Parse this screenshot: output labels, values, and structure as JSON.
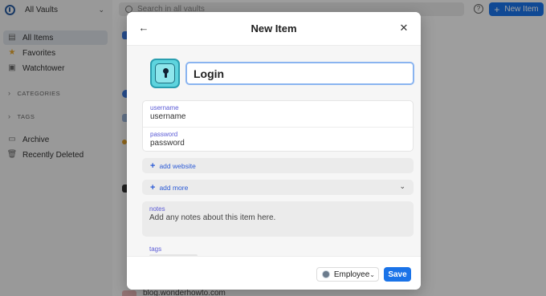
{
  "app": {
    "vault_switcher": {
      "label": "All Vaults",
      "icon": "onepassword-logo-icon"
    },
    "sidebar": {
      "items": [
        {
          "label": "All Items",
          "icon": "all-items-icon",
          "active": true
        },
        {
          "label": "Favorites",
          "icon": "star-icon"
        },
        {
          "label": "Watchtower",
          "icon": "watchtower-icon"
        }
      ],
      "sections": [
        {
          "label": "CATEGORIES"
        },
        {
          "label": "TAGS"
        }
      ],
      "footer_items": [
        {
          "label": "Archive",
          "icon": "archive-icon"
        },
        {
          "label": "Recently Deleted",
          "icon": "trash-icon"
        }
      ]
    },
    "search": {
      "placeholder": "Search in all vaults"
    },
    "new_item_button": {
      "label": "New Item"
    },
    "bottom_list_text": "blog.wonderhowto.com"
  },
  "modal": {
    "title": "New Item",
    "item_title": "Login",
    "fields": [
      {
        "label": "username",
        "placeholder": "username"
      },
      {
        "label": "password",
        "placeholder": "password"
      }
    ],
    "add_website": "add website",
    "add_more": "add more",
    "notes": {
      "label": "notes",
      "placeholder": "Add any notes about this item here."
    },
    "tags": {
      "label": "tags"
    },
    "footer": {
      "vault": "Employee",
      "save": "Save"
    }
  },
  "colors": {
    "accent": "#1a73e8",
    "label_purple": "#5b5bd6",
    "link_blue": "#2c5bd6",
    "login_icon_teal": "#5ed4de"
  }
}
